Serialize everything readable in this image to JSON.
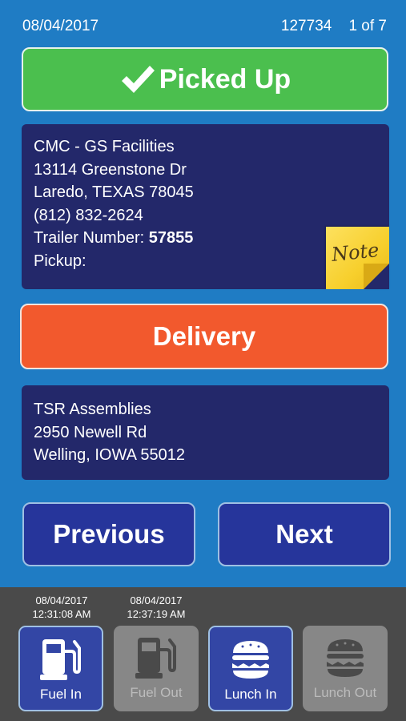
{
  "header": {
    "date": "08/04/2017",
    "order_number": "127734",
    "page_indicator": "1 of 7"
  },
  "pickup": {
    "status_label": "Picked Up",
    "name": "CMC - GS Facilities",
    "street": "13114 Greenstone Dr",
    "city_line": "Laredo, TEXAS 78045",
    "phone": "(812) 832-2624",
    "trailer_label": "Trailer Number: ",
    "trailer_number": "57855",
    "pickup_label": "Pickup:",
    "note_label": "Note"
  },
  "delivery": {
    "button_label": "Delivery",
    "name": "TSR Assemblies",
    "street": "2950 Newell Rd",
    "city_line": "Welling, IOWA 55012"
  },
  "navigation": {
    "previous_label": "Previous",
    "next_label": "Next"
  },
  "actions": [
    {
      "label": "Fuel In",
      "icon": "fuel-pump-icon",
      "state": "active",
      "date": "08/04/2017",
      "time": "12:31:08 AM"
    },
    {
      "label": "Fuel Out",
      "icon": "fuel-pump-icon",
      "state": "disabled",
      "date": "08/04/2017",
      "time": "12:37:19 AM"
    },
    {
      "label": "Lunch In",
      "icon": "burger-icon",
      "state": "active"
    },
    {
      "label": "Lunch Out",
      "icon": "burger-icon",
      "state": "disabled"
    }
  ],
  "colors": {
    "background": "#1f7cc4",
    "picked_up_green": "#4bbf4e",
    "delivery_orange": "#f2592d",
    "card_navy": "#23286a",
    "nav_button": "#26359b",
    "bottom_bar": "#4a4a4a"
  }
}
